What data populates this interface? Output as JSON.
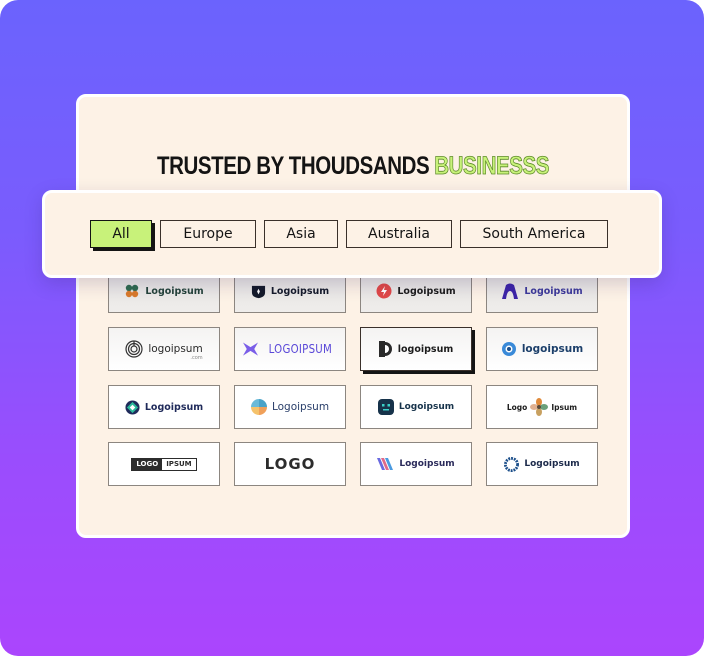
{
  "headline": {
    "dark": "TRUSTED BY THOUDSANDS",
    "accent": "BUSINESSS"
  },
  "filters": [
    {
      "label": "All",
      "active": true
    },
    {
      "label": "Europe",
      "active": false
    },
    {
      "label": "Asia",
      "active": false
    },
    {
      "label": "Australia",
      "active": false
    },
    {
      "label": "South America",
      "active": false
    }
  ],
  "colors": {
    "accent_green": "#c8f27a",
    "panel_bg": "#fdf2e6",
    "gradient_top": "#6b63fd",
    "gradient_bottom": "#ab45fd",
    "ink": "#141414"
  },
  "logos": [
    {
      "text": "Logoipsum",
      "icon": "clover-icon"
    },
    {
      "text": "Logoipsum",
      "icon": "shield-icon"
    },
    {
      "text": "Logoipsum",
      "icon": "bolt-circle-icon"
    },
    {
      "text": "Logoipsum",
      "icon": "arch-icon"
    },
    {
      "text": "logoipsum",
      "sub": ".com",
      "icon": "spiral-icon"
    },
    {
      "text": "LOGOIPSUM",
      "icon": "butterfly-icon"
    },
    {
      "text": "logoipsum",
      "icon": "half-circle-icon",
      "selected": true
    },
    {
      "text": "logoipsum",
      "icon": "ring-icon"
    },
    {
      "text": "Logoipsum",
      "icon": "diamond-icon"
    },
    {
      "text": "Logoipsum",
      "icon": "swirl-icon"
    },
    {
      "text": "Logoipsum",
      "icon": "robot-face-icon"
    },
    {
      "text_left": "Logo",
      "text": "Ipsum",
      "icon": "flower-icon"
    },
    {
      "box_left": "LOGO",
      "box_right": "IPSUM",
      "icon": "box-logo"
    },
    {
      "text": "LOGO",
      "icon": "logo-wordmark"
    },
    {
      "text": "Logoipsum",
      "icon": "stripes-icon"
    },
    {
      "text": "Logoipsum",
      "icon": "gear-ring-icon"
    }
  ]
}
